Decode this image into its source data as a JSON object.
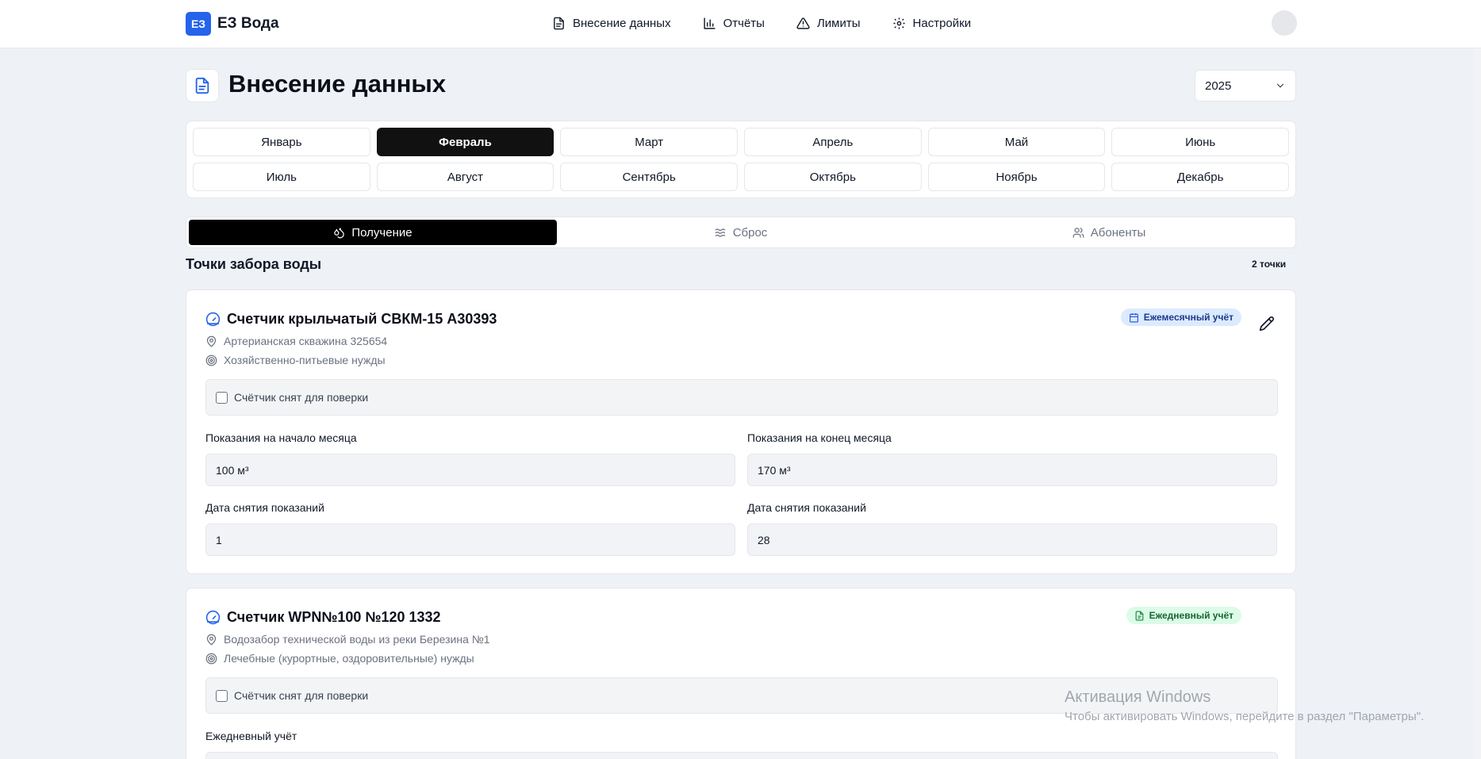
{
  "app": {
    "logo_text": "ЕЗ",
    "name": "ЕЗ Вода"
  },
  "nav": {
    "items": [
      {
        "label": "Внесение данных",
        "icon": "file-text-icon"
      },
      {
        "label": "Отчёты",
        "icon": "bar-chart-icon"
      },
      {
        "label": "Лимиты",
        "icon": "alert-triangle-icon"
      },
      {
        "label": "Настройки",
        "icon": "gear-icon"
      }
    ]
  },
  "page": {
    "title": "Внесение данных"
  },
  "year_select": {
    "value": "2025"
  },
  "months": [
    "Январь",
    "Февраль",
    "Март",
    "Апрель",
    "Май",
    "Июнь",
    "Июль",
    "Август",
    "Сентябрь",
    "Октябрь",
    "Ноябрь",
    "Декабрь"
  ],
  "active_month": "Февраль",
  "tabs": [
    {
      "label": "Получение",
      "icon": "droplets-icon",
      "active": true
    },
    {
      "label": "Сброс",
      "icon": "waves-icon",
      "active": false
    },
    {
      "label": "Абоненты",
      "icon": "users-icon",
      "active": false
    }
  ],
  "section": {
    "title": "Точки забора воды",
    "count": "2 точки"
  },
  "cards": [
    {
      "title": "Счетчик крыльчатый СВКМ-15 А30393",
      "location": "Артерианская скважина 325654",
      "purpose": "Хозяйственно-питьевые нужды",
      "badge": "Ежемесячный учёт",
      "verify_label": "Счётчик снят для поверки",
      "start_label": "Показания на начало месяца",
      "start_value": "100 м³",
      "end_label": "Показания на конец месяца",
      "end_value": "170 м³",
      "start_date_label": "Дата снятия показаний",
      "start_date_value": "1",
      "end_date_label": "Дата снятия показаний",
      "end_date_value": "28"
    },
    {
      "title": "Счетчик WPN№100 №120 1332",
      "location": "Водозабор технической воды из реки Березина №1",
      "purpose": "Лечебные (курортные, оздоровительные) нужды",
      "badge": "Ежедневный учёт",
      "verify_label": "Счётчик снят для поверки",
      "daily_label": "Ежедневный учёт"
    }
  ],
  "watermark": {
    "title": "Активация Windows",
    "subtitle": "Чтобы активировать Windows, перейдите в раздел \"Параметры\"."
  },
  "colors": {
    "brand": "#2563eb",
    "badge_monthly_bg": "#dbeafe",
    "badge_daily_bg": "#dcfce7",
    "active_bg": "#111111"
  }
}
